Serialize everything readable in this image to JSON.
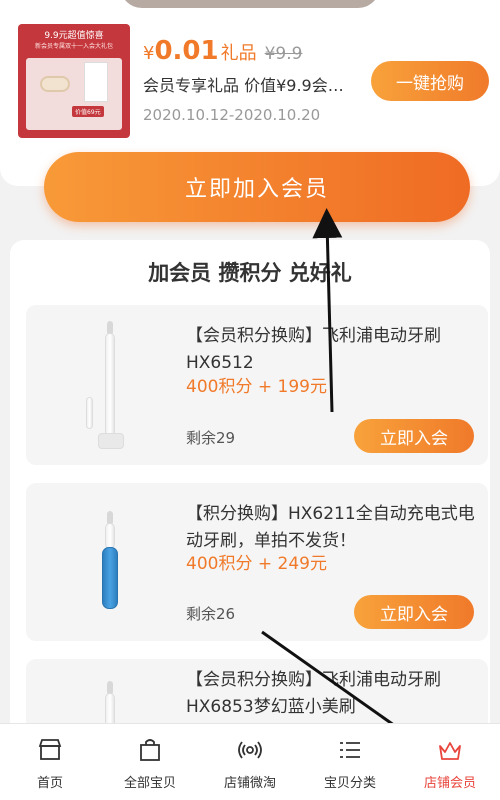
{
  "gift": {
    "image_text_line1": "9.9元超值惊喜",
    "image_text_line2": "新会员专属双十一入会大礼包",
    "image_price_tag": "价值69元",
    "price_currency": "¥",
    "price_value": "0.01",
    "price_unit": "礼品",
    "original_price": "¥9.9",
    "title": "会员专享礼品 价值¥9.9会…",
    "date_range": "2020.10.12-2020.10.20",
    "grab_label": "一键抢购"
  },
  "join_button_label": "立即加入会员",
  "section_title": "加会员 攒积分 兑好礼",
  "products": [
    {
      "title": "【会员积分换购】飞利浦电动牙刷HX6512",
      "points_price": "400积分 + 199元",
      "stock": "剩余29",
      "button": "立即入会"
    },
    {
      "title": "【积分换购】HX6211全自动充电式电动牙刷，单拍不发货！",
      "points_price": "400积分 + 249元",
      "stock": "剩余26",
      "button": "立即入会"
    },
    {
      "title": "【会员积分换购】飞利浦电动牙刷HX6853梦幻蓝小美刷",
      "points_price": "",
      "stock": "",
      "button": ""
    }
  ],
  "bottom_nav": [
    {
      "label": "首页",
      "icon": "shop-icon",
      "active": false
    },
    {
      "label": "全部宝贝",
      "icon": "bag-icon",
      "active": false
    },
    {
      "label": "店铺微淘",
      "icon": "broadcast-icon",
      "active": false
    },
    {
      "label": "宝贝分类",
      "icon": "list-icon",
      "active": false
    },
    {
      "label": "店铺会员",
      "icon": "crown-icon",
      "active": true
    }
  ],
  "colors": {
    "accent": "#f07a2a",
    "active_nav": "#e8453c",
    "gift_red": "#c4373c"
  }
}
